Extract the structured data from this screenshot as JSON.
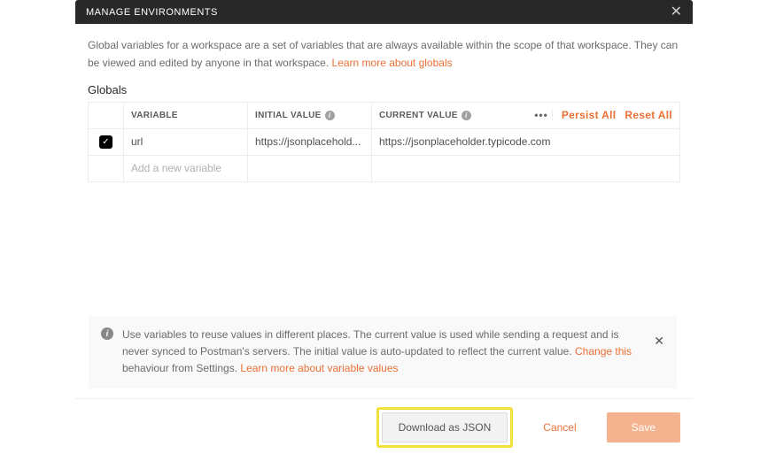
{
  "header": {
    "title": "MANAGE ENVIRONMENTS"
  },
  "description": {
    "text_1": "Global variables for a workspace are a set of variables that are always available within the scope of that workspace. They can be viewed and edited by anyone in that workspace. ",
    "link_1": "Learn more about globals"
  },
  "section_title": "Globals",
  "table": {
    "headers": {
      "variable": "VARIABLE",
      "initial": "INITIAL VALUE",
      "current": "CURRENT VALUE"
    },
    "actions": {
      "more": "•••",
      "persist": "Persist All",
      "reset": "Reset All"
    },
    "rows": [
      {
        "checked": true,
        "variable": "url",
        "initial": "https://jsonplacehold...",
        "current": "https://jsonplaceholder.typicode.com"
      }
    ],
    "new_row_placeholder": "Add a new variable"
  },
  "hint": {
    "text_1": "Use variables to reuse values in different places. The current value is used while sending a request and is never synced to Postman's servers. The initial value is auto-updated to reflect the current value. ",
    "link_1": "Change this",
    "text_2": " behaviour from Settings. ",
    "link_2": "Learn more about variable values"
  },
  "footer": {
    "download": "Download as JSON",
    "cancel": "Cancel",
    "save": "Save"
  }
}
